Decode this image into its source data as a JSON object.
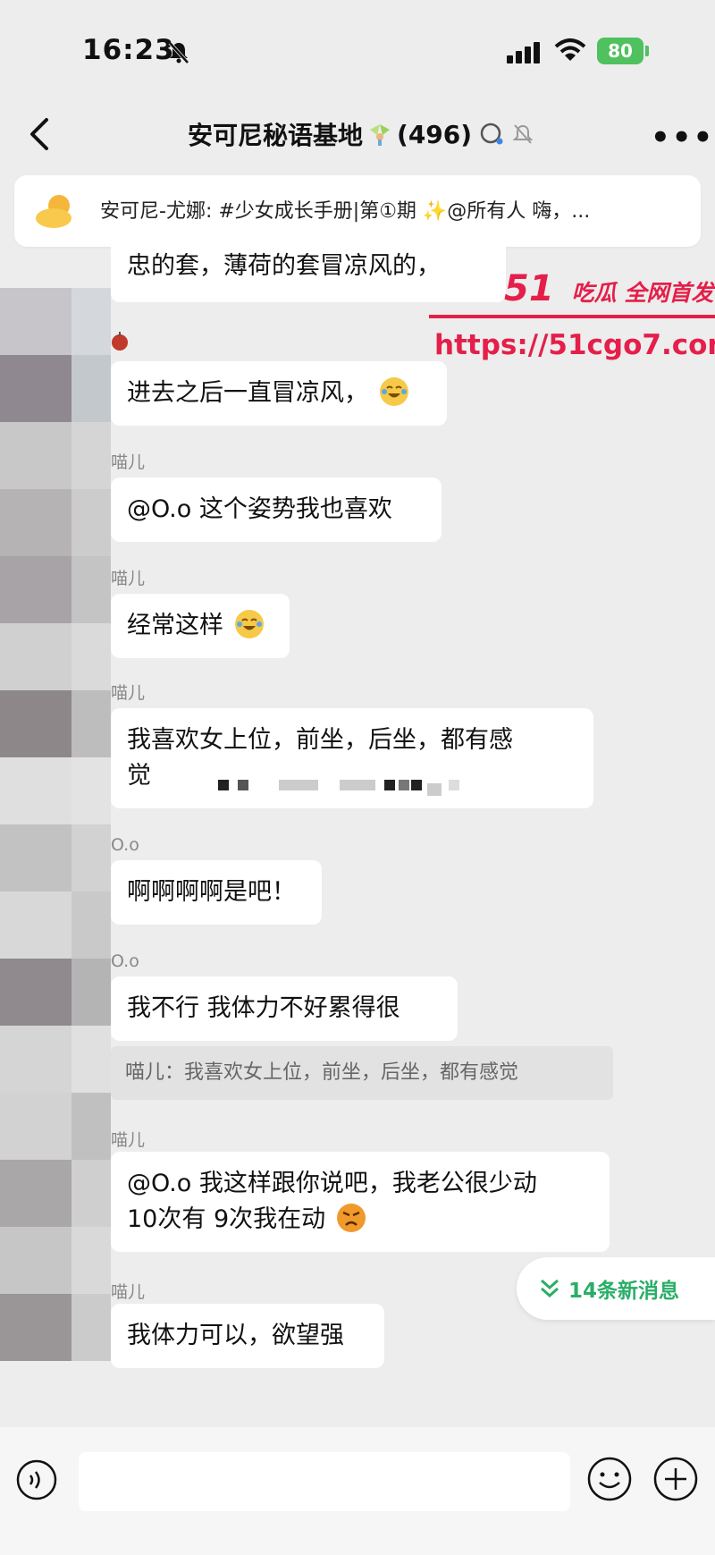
{
  "status": {
    "time": "16:23",
    "battery": "80"
  },
  "header": {
    "title": "安可尼秘语基地",
    "member_count": "(496)"
  },
  "announcement": {
    "text": "安可尼-尤娜: #少女成长手册|第①期 ✨@所有人  嗨，..."
  },
  "watermark": {
    "brand": "51",
    "tagline": "吃瓜 全网首发",
    "url": "https://51cgo7.com"
  },
  "messages": [
    {
      "sender": "",
      "text": "忠的套，薄荷的套冒凉风的，"
    },
    {
      "sender": "",
      "text": "进去之后一直冒凉风，"
    },
    {
      "sender": "喵儿",
      "text": "@O.o 这个姿势我也喜欢"
    },
    {
      "sender": "喵儿",
      "text": "经常这样"
    },
    {
      "sender": "喵儿",
      "text_line1": "我喜欢女上位，前坐，后坐，都有感",
      "text_line2": "觉"
    },
    {
      "sender": "O.o",
      "text": "啊啊啊啊是吧！"
    },
    {
      "sender": "O.o",
      "text": "我不行 我体力不好累得很",
      "quote": "喵儿：我喜欢女上位，前坐，后坐，都有感觉"
    },
    {
      "sender": "喵儿",
      "text_line1": "@O.o 我这样跟你说吧，我老公很少动",
      "text_line2": "10次有 9次我在动"
    },
    {
      "sender": "喵儿",
      "text": "我体力可以，欲望强"
    }
  ],
  "new_messages": {
    "label": "14条新消息"
  }
}
